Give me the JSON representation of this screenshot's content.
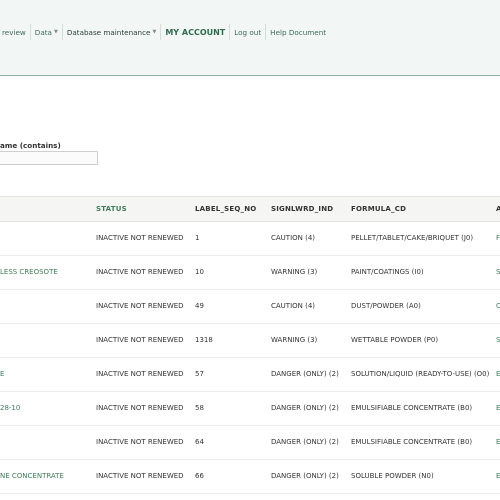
{
  "nav": {
    "items": [
      {
        "label": "review",
        "dropdown": false
      },
      {
        "label": "Data",
        "dropdown": true
      },
      {
        "label": "Database maintenance",
        "dropdown": true
      },
      {
        "label": "MY ACCOUNT",
        "dropdown": false
      },
      {
        "label": "Log out",
        "dropdown": false
      },
      {
        "label": "Help Document",
        "dropdown": false
      }
    ],
    "caret": "▼"
  },
  "filter": {
    "label": "ame (contains)",
    "value": "",
    "placeholder": ""
  },
  "table": {
    "columns": [
      "",
      "STATUS",
      "LABEL_SEQ_NO",
      "SIGNLWRD_IND",
      "FORMULA_CD",
      "A"
    ],
    "rows": [
      {
        "name": "",
        "status": "INACTIVE NOT RENEWED",
        "label_seq_no": "1",
        "signlwrd_ind": "CAUTION (4)",
        "formula_cd": "PELLET/TABLET/CAKE/BRIQUET (J0)",
        "extra": "F"
      },
      {
        "name": "LESS CREOSOTE",
        "status": "INACTIVE NOT RENEWED",
        "label_seq_no": "10",
        "signlwrd_ind": "WARNING (3)",
        "formula_cd": "PAINT/COATINGS (I0)",
        "extra": "S"
      },
      {
        "name": "",
        "status": "INACTIVE NOT RENEWED",
        "label_seq_no": "49",
        "signlwrd_ind": "CAUTION (4)",
        "formula_cd": "DUST/POWDER (A0)",
        "extra": "C"
      },
      {
        "name": "",
        "status": "INACTIVE NOT RENEWED",
        "label_seq_no": "1318",
        "signlwrd_ind": "WARNING (3)",
        "formula_cd": "WETTABLE POWDER (P0)",
        "extra": "S ("
      },
      {
        "name": "E",
        "status": "INACTIVE NOT RENEWED",
        "label_seq_no": "57",
        "signlwrd_ind": "DANGER (ONLY) (2)",
        "formula_cd": "SOLUTION/LIQUID (READY-TO-USE) (O0)",
        "extra": "E"
      },
      {
        "name": "28-10",
        "status": "INACTIVE NOT RENEWED",
        "label_seq_no": "58",
        "signlwrd_ind": "DANGER (ONLY) (2)",
        "formula_cd": "EMULSIFIABLE CONCENTRATE (B0)",
        "extra": "E"
      },
      {
        "name": "",
        "status": "INACTIVE NOT RENEWED",
        "label_seq_no": "64",
        "signlwrd_ind": "DANGER (ONLY) (2)",
        "formula_cd": "EMULSIFIABLE CONCENTRATE (B0)",
        "extra": "E"
      },
      {
        "name": "NE CONCENTRATE",
        "status": "INACTIVE NOT RENEWED",
        "label_seq_no": "66",
        "signlwrd_ind": "DANGER (ONLY) (2)",
        "formula_cd": "SOLUBLE POWDER (N0)",
        "extra": "E"
      }
    ]
  },
  "colors": {
    "accent": "#3f7b5c",
    "header_bg": "#f2f7f5",
    "header_border": "#8fae9f"
  }
}
